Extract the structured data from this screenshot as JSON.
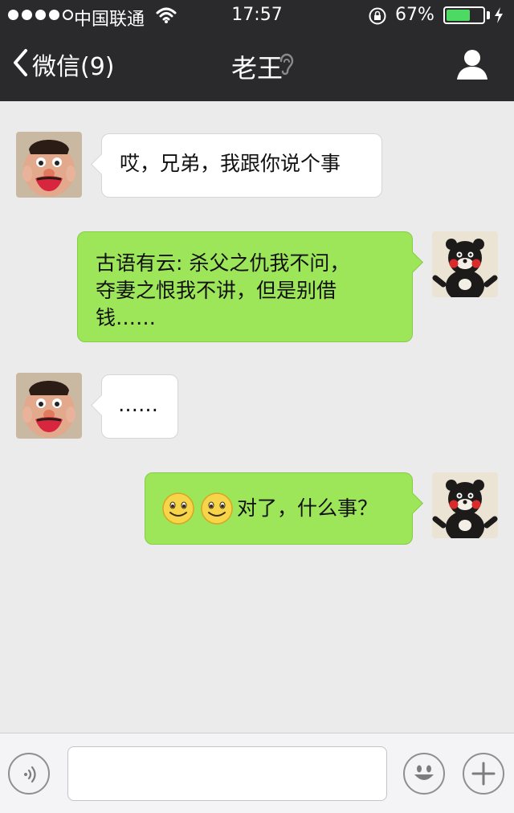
{
  "status": {
    "carrier": "中国联通",
    "time": "17:57",
    "battery_pct": "67%",
    "battery_level": 0.67,
    "signal_bars_filled": 4,
    "signal_bars_total": 5
  },
  "nav": {
    "back_label": "微信(9)",
    "title": "老王"
  },
  "colors": {
    "topbar": "#2a2a2c",
    "chat_bg": "#ebebeb",
    "bubble_self": "#9de65a",
    "bubble_other": "#ffffff",
    "battery": "#4cd964"
  },
  "messages": [
    {
      "sender": "other",
      "text": "哎，兄弟，我跟你说个事"
    },
    {
      "sender": "self",
      "lines": [
        "古语有云: 杀父之仇我不问，",
        "夺妻之恨我不讲，但是别借",
        "钱……"
      ]
    },
    {
      "sender": "other",
      "text": "……"
    },
    {
      "sender": "self",
      "emoji": [
        "smile-emoji",
        "smile-emoji"
      ],
      "text": "对了，什么事？"
    }
  ],
  "input": {
    "placeholder": "",
    "voice_icon": "voice-icon",
    "emoji_icon": "emoji-icon",
    "plus_icon": "plus-icon"
  }
}
